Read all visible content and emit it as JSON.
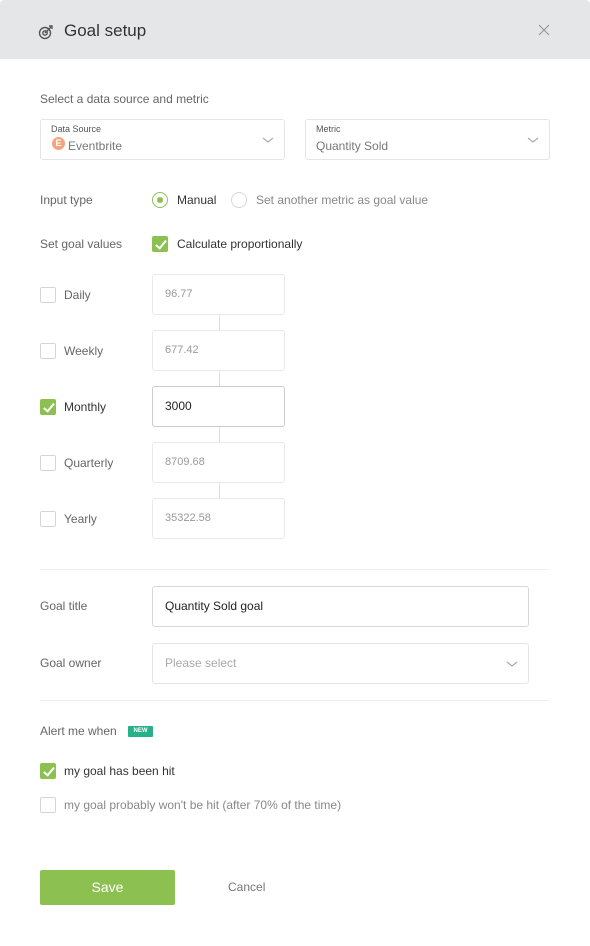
{
  "dialog": {
    "title": "Goal setup",
    "header_icon": "target-icon",
    "close_icon": "close-icon"
  },
  "source_section": {
    "label": "Select a data source and metric",
    "data_source": {
      "small_label": "Data Source",
      "value": "Eventbrite",
      "badge": "E",
      "badge_color": "#f4a57f"
    },
    "metric": {
      "small_label": "Metric",
      "value": "Quantity Sold"
    }
  },
  "input_type": {
    "label": "Input type",
    "options": [
      {
        "label": "Manual",
        "selected": true
      },
      {
        "label": "Set another metric as goal value",
        "selected": false
      }
    ]
  },
  "goal_values": {
    "label": "Set goal values",
    "proportional_label": "Calculate proportionally",
    "proportional_checked": true,
    "rows": [
      {
        "label": "Daily",
        "value": "96.77",
        "checked": false
      },
      {
        "label": "Weekly",
        "value": "677.42",
        "checked": false
      },
      {
        "label": "Monthly",
        "value": "3000",
        "checked": true
      },
      {
        "label": "Quarterly",
        "value": "8709.68",
        "checked": false
      },
      {
        "label": "Yearly",
        "value": "35322.58",
        "checked": false
      }
    ]
  },
  "goal_title": {
    "label": "Goal title",
    "value": "Quantity Sold goal"
  },
  "goal_owner": {
    "label": "Goal owner",
    "placeholder": "Please select"
  },
  "alerts": {
    "label": "Alert me when",
    "badge": "NEW",
    "badge_color": "#27b089",
    "options": [
      {
        "label": "my goal has been hit",
        "checked": true
      },
      {
        "label": "my goal probably won't be hit (after 70% of the time)",
        "checked": false
      }
    ]
  },
  "actions": {
    "save": "Save",
    "cancel": "Cancel"
  },
  "colors": {
    "accent": "#8cc152",
    "header_bg": "#e5e6e8"
  }
}
